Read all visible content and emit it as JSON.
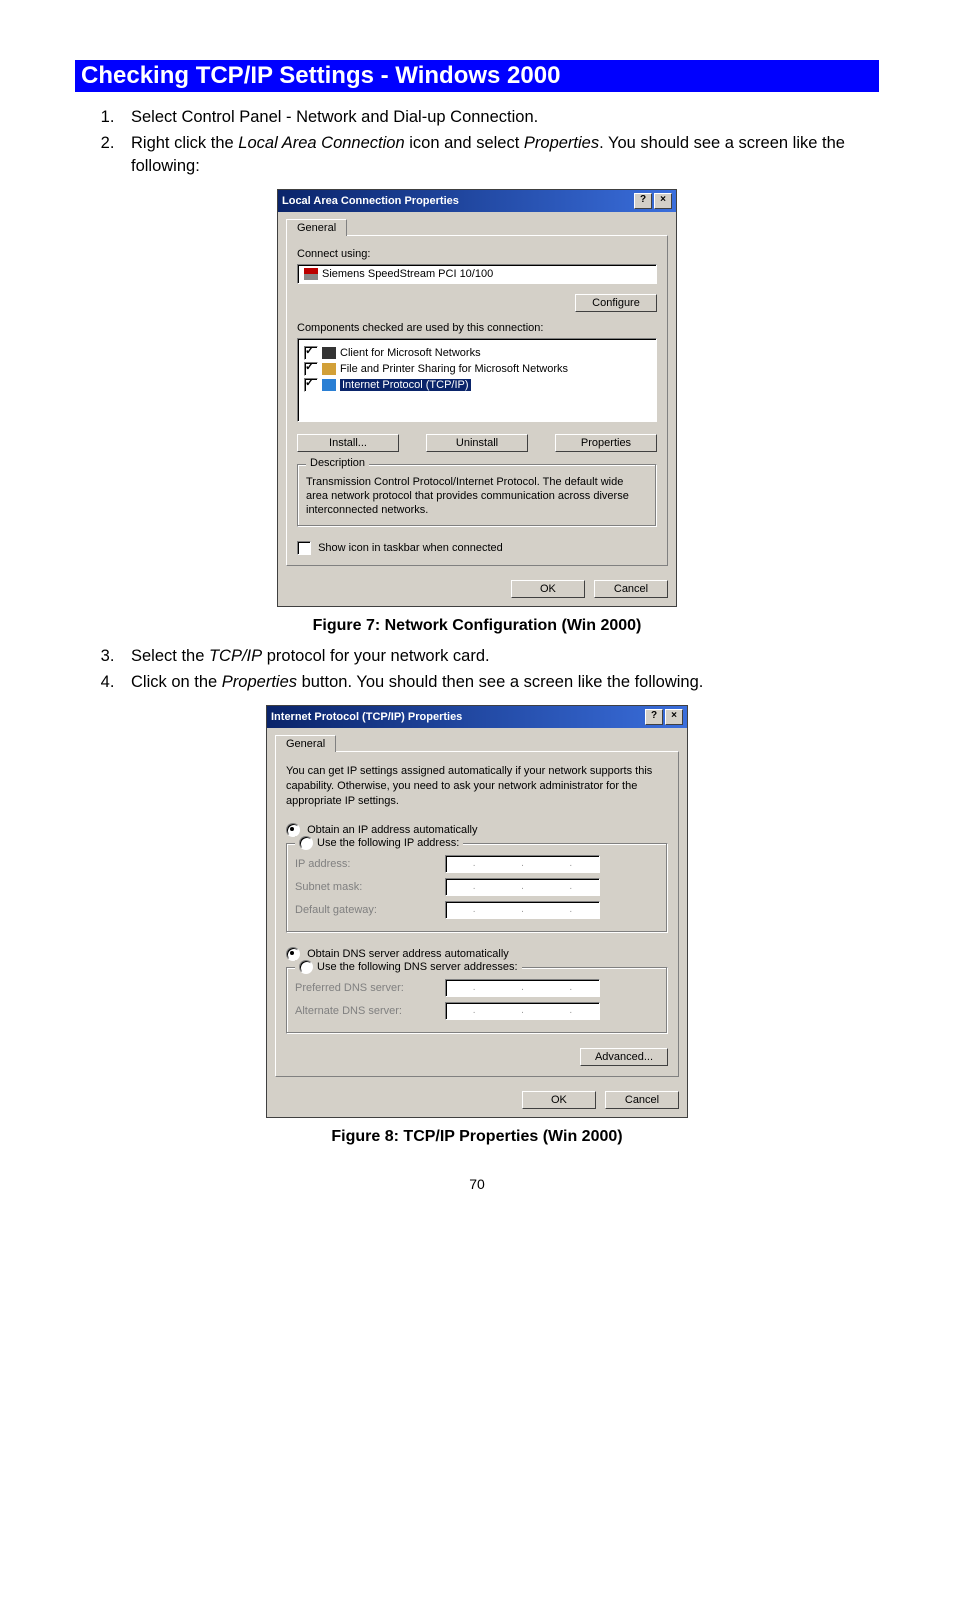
{
  "heading": "Checking TCP/IP Settings - Windows 2000",
  "step1": "Select Control Panel - Network and Dial-up Connection.",
  "step2a": "Right click the ",
  "step2_em1": "Local Area Connection",
  "step2b": " icon and select ",
  "step2_em2": "Properties",
  "step2c": ". You should see a screen like the following:",
  "fig1_caption": "Figure 7: Network Configuration (Win 2000)",
  "step3a": "Select the ",
  "step3_em": "TCP/IP",
  "step3b": " protocol for your network card.",
  "step4a": "Click on the ",
  "step4_em": "Properties",
  "step4b": " button. You should then see a screen like the following.",
  "fig2_caption": "Figure 8: TCP/IP Properties (Win 2000)",
  "page_number": "70",
  "dlg1": {
    "title": "Local Area Connection Properties",
    "tab": "General",
    "connect_using": "Connect using:",
    "adapter": "Siemens SpeedStream PCI 10/100",
    "configure": "Configure",
    "components_label": "Components checked are used by this connection:",
    "items": {
      "client": "Client for Microsoft Networks",
      "file": "File and Printer Sharing for Microsoft Networks",
      "tcp": "Internet Protocol (TCP/IP)"
    },
    "install": "Install...",
    "uninstall": "Uninstall",
    "properties": "Properties",
    "desc_legend": "Description",
    "desc_text": "Transmission Control Protocol/Internet Protocol. The default wide area network protocol that provides communication across diverse interconnected networks.",
    "show_icon": "Show icon in taskbar when connected",
    "ok": "OK",
    "cancel": "Cancel"
  },
  "dlg2": {
    "title": "Internet Protocol (TCP/IP) Properties",
    "tab": "General",
    "info": "You can get IP settings assigned automatically if your network supports this capability. Otherwise, you need to ask your network administrator for the appropriate IP settings.",
    "obtain_ip": "Obtain an IP address automatically",
    "use_ip": "Use the following IP address:",
    "ip_address": "IP address:",
    "subnet": "Subnet mask:",
    "gateway": "Default gateway:",
    "obtain_dns": "Obtain DNS server address automatically",
    "use_dns": "Use the following DNS server addresses:",
    "pref_dns": "Preferred DNS server:",
    "alt_dns": "Alternate DNS server:",
    "advanced": "Advanced...",
    "ok": "OK",
    "cancel": "Cancel"
  }
}
